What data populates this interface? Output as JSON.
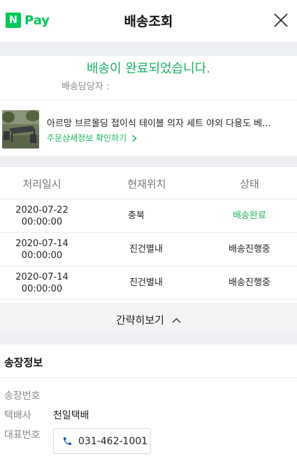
{
  "header": {
    "logo_n": "N",
    "logo_text": "Pay",
    "title": "배송조회",
    "close_icon": "close-icon"
  },
  "status": {
    "message": "배송이 완료되었습니다.",
    "courier_label": "배송담당자 :"
  },
  "product": {
    "name": "아르망 브르몰딩 접이식 테이블 의자 세트 야외 다용도 베...",
    "detail_link": "주문상세정보 확인하기"
  },
  "tracking": {
    "headers": [
      "처리일시",
      "현재위치",
      "상태"
    ],
    "rows": [
      {
        "date": "2020-07-22",
        "time": "00:00:00",
        "location": "충북",
        "status": "배송완료"
      },
      {
        "date": "2020-07-14",
        "time": "00:00:00",
        "location": "진건별내",
        "status": "배송진행중"
      },
      {
        "date": "2020-07-14",
        "time": "00:00:00",
        "location": "진건별내",
        "status": "배송진행중"
      }
    ],
    "collapse_label": "간략히보기"
  },
  "invoice": {
    "title": "송장정보",
    "labels": {
      "number": "송장번호",
      "carrier": "택배사",
      "phone": "대표번호"
    },
    "carrier_value": "천일택배",
    "phone_value": "031-462-1001"
  },
  "colors": {
    "brand_green": "#03c75a",
    "status_green": "#18b35c",
    "band_gray": "#eceef1"
  }
}
